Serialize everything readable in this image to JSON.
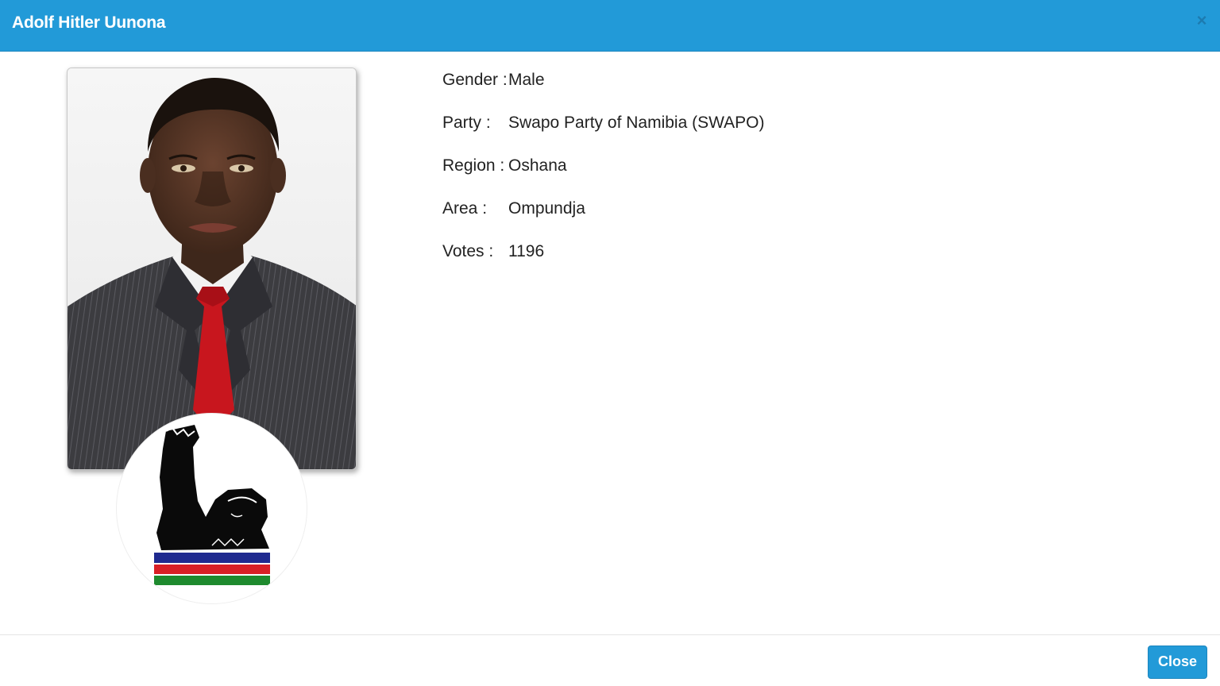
{
  "modal": {
    "title": "Adolf Hitler Uunona",
    "close_icon": "×",
    "close_button_label": "Close"
  },
  "details": {
    "rows": [
      {
        "label": "Gender",
        "separator": " :",
        "value": "Male"
      },
      {
        "label": "Party",
        "separator": " :",
        "value": "Swapo Party of Namibia (SWAPO)"
      },
      {
        "label": "Region",
        "separator": " :",
        "value": "Oshana"
      },
      {
        "label": "Area",
        "separator": " :",
        "value": "Ompundja"
      },
      {
        "label": "Votes",
        "separator": " :",
        "value": "1196"
      }
    ]
  },
  "icons": {
    "close": "close-icon",
    "party_logo": "raised-fist-logo"
  },
  "colors": {
    "header": "#229ad8",
    "button": "#229ad8",
    "flag_blue": "#1f2a8f",
    "flag_red": "#d81f26",
    "flag_green": "#1e8a2e"
  }
}
